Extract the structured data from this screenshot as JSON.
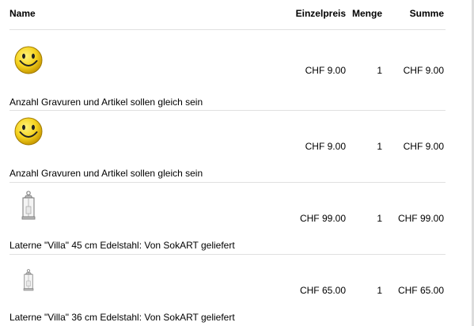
{
  "table": {
    "headers": {
      "name": "Name",
      "unit_price": "Einzelpreis",
      "quantity": "Menge",
      "total": "Summe"
    },
    "rows": [
      {
        "icon": "smiley-icon",
        "unit_price": "CHF 9.00",
        "quantity": "1",
        "total": "CHF 9.00",
        "description": "Anzahl Gravuren und Artikel sollen gleich sein"
      },
      {
        "icon": "smiley-icon",
        "unit_price": "CHF 9.00",
        "quantity": "1",
        "total": "CHF 9.00",
        "description": "Anzahl Gravuren und Artikel sollen gleich sein"
      },
      {
        "icon": "lantern-icon",
        "unit_price": "CHF 99.00",
        "quantity": "1",
        "total": "CHF 99.00",
        "description": "Laterne \"Villa\" 45 cm Edelstahl: Von SokART geliefert"
      },
      {
        "icon": "lantern-icon",
        "unit_price": "CHF 65.00",
        "quantity": "1",
        "total": "CHF 65.00",
        "description": "Laterne \"Villa\" 36 cm Edelstahl: Von SokART geliefert"
      }
    ]
  },
  "colors": {
    "smiley_fill": "#f5d21f",
    "divider": "#e0e0e0"
  }
}
